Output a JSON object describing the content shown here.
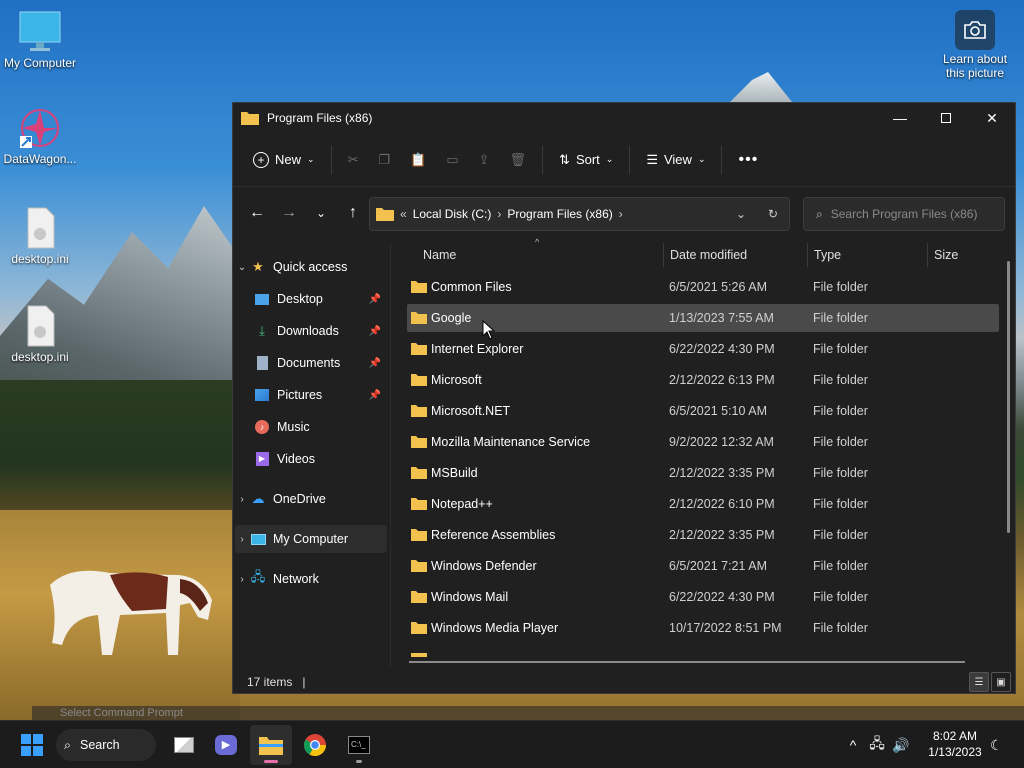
{
  "desktop": {
    "icons": [
      {
        "label": "My Computer",
        "icon": "monitor-icon"
      },
      {
        "label": "DataWagon...",
        "icon": "datawagon-app-icon"
      },
      {
        "label": "desktop.ini",
        "icon": "ini-file-icon"
      },
      {
        "label": "desktop.ini",
        "icon": "ini-file-icon"
      }
    ],
    "learn": {
      "label_line1": "Learn about",
      "label_line2": "this picture",
      "icon": "camera-icon"
    }
  },
  "window": {
    "title": "Program Files (x86)",
    "controls": {
      "minimize": "minimize-icon",
      "maximize": "maximize-icon",
      "close": "close-icon"
    }
  },
  "commandbar": {
    "new_label": "New",
    "sort_label": "Sort",
    "view_label": "View",
    "more": "more-icon"
  },
  "address": {
    "crumbs": [
      "Local Disk (C:)",
      "Program Files (x86)"
    ],
    "prefix": "«"
  },
  "search": {
    "placeholder": "Search Program Files (x86)"
  },
  "navpane": {
    "quick_access": "Quick access",
    "items": [
      {
        "label": "Desktop",
        "icon": "desktop-icon",
        "pinned": true,
        "color": "#4aa3e8"
      },
      {
        "label": "Downloads",
        "icon": "download-icon",
        "pinned": true,
        "color": "#3fbf7f"
      },
      {
        "label": "Documents",
        "icon": "document-icon",
        "pinned": true,
        "color": "#9fb3c8"
      },
      {
        "label": "Pictures",
        "icon": "picture-icon",
        "pinned": true,
        "color": "#4aa3e8"
      },
      {
        "label": "Music",
        "icon": "music-icon",
        "pinned": false,
        "color": "#e86a5a"
      },
      {
        "label": "Videos",
        "icon": "video-icon",
        "pinned": false,
        "color": "#9b6ae8"
      }
    ],
    "onedrive": "OneDrive",
    "mycomputer": "My Computer",
    "network": "Network"
  },
  "columns": {
    "name": "Name",
    "date": "Date modified",
    "type": "Type",
    "size": "Size"
  },
  "files": [
    {
      "name": "Common Files",
      "date": "6/5/2021 5:26 AM",
      "type": "File folder"
    },
    {
      "name": "Google",
      "date": "1/13/2023 7:55 AM",
      "type": "File folder"
    },
    {
      "name": "Internet Explorer",
      "date": "6/22/2022 4:30 PM",
      "type": "File folder"
    },
    {
      "name": "Microsoft",
      "date": "2/12/2022 6:13 PM",
      "type": "File folder"
    },
    {
      "name": "Microsoft.NET",
      "date": "6/5/2021 5:10 AM",
      "type": "File folder"
    },
    {
      "name": "Mozilla Maintenance Service",
      "date": "9/2/2022 12:32 AM",
      "type": "File folder"
    },
    {
      "name": "MSBuild",
      "date": "2/12/2022 3:35 PM",
      "type": "File folder"
    },
    {
      "name": "Notepad++",
      "date": "2/12/2022 6:10 PM",
      "type": "File folder"
    },
    {
      "name": "Reference Assemblies",
      "date": "2/12/2022 3:35 PM",
      "type": "File folder"
    },
    {
      "name": "Windows Defender",
      "date": "6/5/2021 7:21 AM",
      "type": "File folder"
    },
    {
      "name": "Windows Mail",
      "date": "6/22/2022 4:30 PM",
      "type": "File folder"
    },
    {
      "name": "Windows Media Player",
      "date": "10/17/2022 8:51 PM",
      "type": "File folder"
    }
  ],
  "hovered_row": "Google",
  "status": {
    "count": "17 items",
    "caret": "|"
  },
  "ghost_window": "Select Command Prompt",
  "taskbar": {
    "search_label": "Search",
    "clock_time": "8:02 AM",
    "clock_date": "1/13/2023",
    "accent": "#e56fa8"
  },
  "colors": {
    "folder": "#f2c14e",
    "window_bg": "#202020",
    "hover": "#4a4a4a"
  }
}
